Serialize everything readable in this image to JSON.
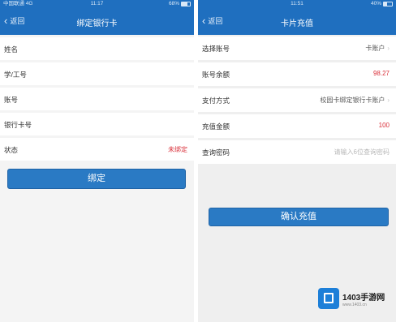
{
  "left": {
    "status": {
      "carrier": "中国联通  4G",
      "time": "11:17",
      "battery": "68%",
      "battery_level": 0.68
    },
    "nav": {
      "back": "返回",
      "title": "绑定银行卡"
    },
    "fields": [
      {
        "label": "姓名",
        "value": ""
      },
      {
        "label": "学/工号",
        "value": ""
      },
      {
        "label": "账号",
        "value": ""
      },
      {
        "label": "银行卡号",
        "value": ""
      },
      {
        "label": "状态",
        "value": "未绑定"
      }
    ],
    "bind_button": "绑定"
  },
  "right": {
    "status": {
      "carrier": "",
      "time": "11:51",
      "battery": "40%",
      "battery_level": 0.4
    },
    "nav": {
      "back": "返回",
      "title": "卡片充值"
    },
    "fields": [
      {
        "label": "选择账号",
        "value": "卡账户"
      },
      {
        "label": "账号余额",
        "value": "98.27"
      },
      {
        "label": "支付方式",
        "value": "校园卡绑定银行卡账户"
      },
      {
        "label": "充值金额",
        "value": "100"
      },
      {
        "label": "查询密码",
        "value": "请输入6位查询密码"
      }
    ],
    "confirm_button": "确认充值"
  },
  "watermark": {
    "brand": "1403手游网",
    "url": "www.1403.cn"
  },
  "colors": {
    "primary": "#1f6fbf",
    "button": "#2a7ac4",
    "alert": "#d9303a"
  }
}
